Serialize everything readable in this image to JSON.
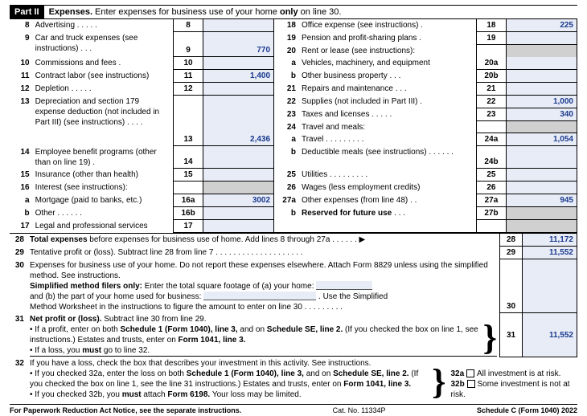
{
  "part": {
    "label": "Part II",
    "title_bold": "Expenses.",
    "title_rest": " Enter expenses for business use of your home ",
    "title_bold2": "only",
    "title_rest2": " on line 30."
  },
  "l8": {
    "n": "8",
    "desc": "Advertising . . . . .",
    "box": "8",
    "val": ""
  },
  "l9": {
    "n": "9",
    "desc": "Car and truck expenses (see instructions) . . .",
    "box": "9",
    "val": "770"
  },
  "l10": {
    "n": "10",
    "desc": "Commissions and fees .",
    "box": "10",
    "val": ""
  },
  "l11": {
    "n": "11",
    "desc": "Contract labor (see instructions)",
    "box": "11",
    "val": "1,400"
  },
  "l12": {
    "n": "12",
    "desc": "Depletion . . . . .",
    "box": "12",
    "val": ""
  },
  "l13": {
    "n": "13",
    "desc": "Depreciation and section 179 expense deduction (not included in Part III) (see instructions) . . . .",
    "box": "13",
    "val": "2,436"
  },
  "l14": {
    "n": "14",
    "desc": "Employee benefit programs (other than on line 19)  .",
    "box": "14",
    "val": ""
  },
  "l15": {
    "n": "15",
    "desc": "Insurance (other than health)",
    "box": "15",
    "val": ""
  },
  "l16": {
    "n": "16",
    "desc": "Interest (see instructions):"
  },
  "l16a": {
    "n": "a",
    "desc": "Mortgage (paid to banks, etc.)",
    "box": "16a",
    "val": "3002"
  },
  "l16b": {
    "n": "b",
    "desc": "Other . . . . . .",
    "box": "16b",
    "val": ""
  },
  "l17": {
    "n": "17",
    "desc": "Legal and professional services",
    "box": "17",
    "val": ""
  },
  "l18": {
    "n": "18",
    "desc": "Office expense (see instructions) .",
    "box": "18",
    "val": "225"
  },
  "l19": {
    "n": "19",
    "desc": "Pension and profit-sharing plans .",
    "box": "19",
    "val": ""
  },
  "l20": {
    "n": "20",
    "desc": "Rent or lease (see instructions):"
  },
  "l20a": {
    "n": "a",
    "desc": "Vehicles, machinery, and equipment",
    "box": "20a",
    "val": ""
  },
  "l20b": {
    "n": "b",
    "desc": "Other business property . . .",
    "box": "20b",
    "val": ""
  },
  "l21": {
    "n": "21",
    "desc": "Repairs and maintenance . . .",
    "box": "21",
    "val": ""
  },
  "l22": {
    "n": "22",
    "desc": "Supplies (not included in Part III) .",
    "box": "22",
    "val": "1,000"
  },
  "l23": {
    "n": "23",
    "desc": "Taxes and licenses . . . . .",
    "box": "23",
    "val": "340"
  },
  "l24": {
    "n": "24",
    "desc": "Travel and meals:"
  },
  "l24a": {
    "n": "a",
    "desc": "Travel . . . . . . . . .",
    "box": "24a",
    "val": "1,054"
  },
  "l24b": {
    "n": "b",
    "desc": "Deductible meals (see instructions) . . . . . .",
    "box": "24b",
    "val": ""
  },
  "l25": {
    "n": "25",
    "desc": "Utilities . . . . . . . . .",
    "box": "25",
    "val": ""
  },
  "l26": {
    "n": "26",
    "desc": "Wages (less employment credits)",
    "box": "26",
    "val": ""
  },
  "l27a": {
    "n": "27a",
    "desc": "Other expenses (from line 48) . .",
    "box": "27a",
    "val": "945"
  },
  "l27b": {
    "n": "b",
    "desc_bold": "Reserved for future use",
    "dots": " . . .",
    "box": "27b"
  },
  "l28": {
    "n": "28",
    "desc_bold": "Total expenses",
    "desc_rest": " before expenses for business use of home. Add lines 8 through 27a . . . . . . ▶",
    "box": "28",
    "val": "11,172"
  },
  "l29": {
    "n": "29",
    "desc": "Tentative profit or (loss). Subtract line 28 from line 7 . . . . . . . . . . . . . . . . . . . .",
    "box": "29",
    "val": "11,552"
  },
  "l30": {
    "n": "30",
    "p1": "Expenses for business use of your home. Do not report these expenses elsewhere. Attach Form 8829 unless using the simplified method. See instructions.",
    "p2_bold": "Simplified method filers only:",
    "p2_rest": " Enter the total square footage of (a) your home:",
    "p3a": "and (b) the part of your home used for business:",
    "p3b": ". Use the Simplified",
    "p4": "Method Worksheet in the instructions to figure the amount to enter on line 30  . . . . . . . . .",
    "box": "30",
    "val": ""
  },
  "l31": {
    "n": "31",
    "desc_bold": "Net profit or (loss).",
    "desc_rest": " Subtract line 30 from line 29.",
    "bul1a": "• If a profit, enter on both ",
    "bul1b": "Schedule 1 (Form 1040), line 3,",
    "bul1c": " and on ",
    "bul1d": "Schedule SE, line 2.",
    "bul1e": " (If you checked the box on line 1, see instructions.) Estates and trusts, enter on ",
    "bul1f": "Form 1041, line 3.",
    "bul2a": "• If a loss, you ",
    "bul2b": "must",
    "bul2c": " go to line 32.",
    "box": "31",
    "val": "11,552"
  },
  "l32": {
    "n": "32",
    "desc": "If you have a loss, check the box that describes your investment in this activity. See instructions.",
    "bul1a": "• If you checked 32a, enter the loss on both ",
    "bul1b": "Schedule 1 (Form 1040), line 3,",
    "bul1c": " and on ",
    "bul1d": "Schedule SE, line 2.",
    "bul1e": " (If you checked the box on line 1, see the line 31 instructions.) Estates and trusts, enter on ",
    "bul1f": "Form 1041, line 3.",
    "bul2a": "• If you checked 32b, you ",
    "bul2b": "must",
    "bul2c": " attach ",
    "bul2d": "Form 6198.",
    "bul2e": " Your loss may be limited.",
    "box_a": "32a",
    "opt_a": "All investment is at risk.",
    "box_b": "32b",
    "opt_b": "Some investment is not at risk."
  },
  "footer": {
    "left": "For Paperwork Reduction Act Notice, see the separate instructions.",
    "mid": "Cat. No. 11334P",
    "right": "Schedule C (Form 1040) 2022"
  }
}
